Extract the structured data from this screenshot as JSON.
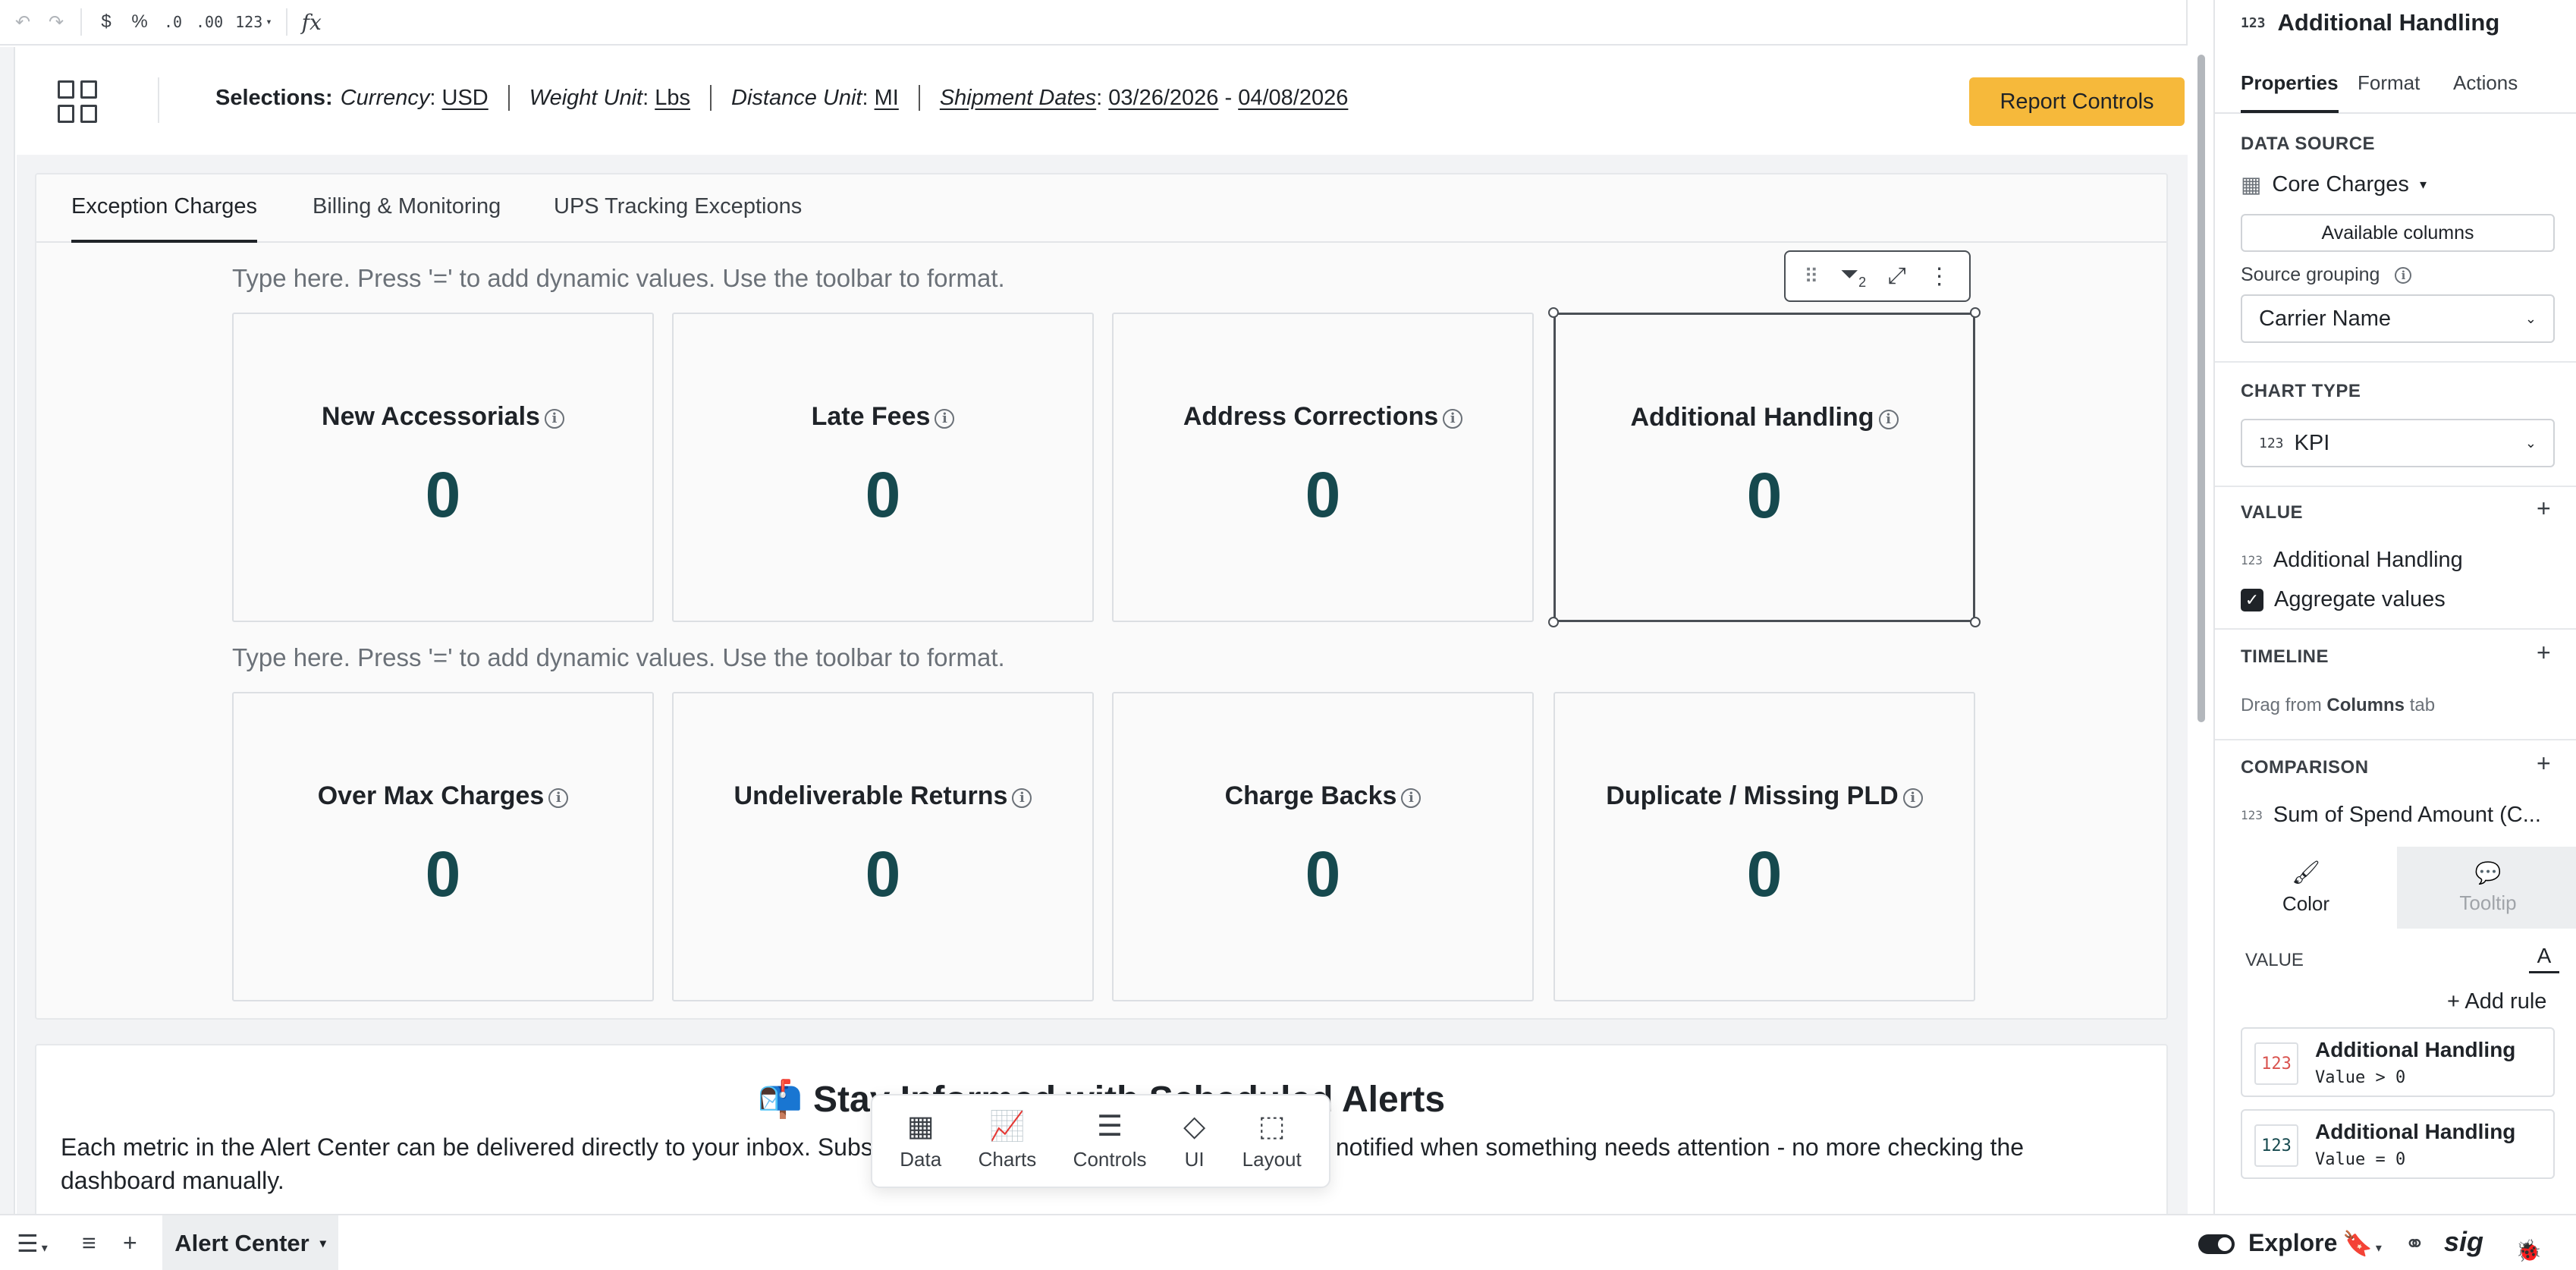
{
  "toolbar": {
    "undo": "↶",
    "redo": "↷",
    "currency": "$",
    "percent": "%",
    "decrease_decimals": ".0",
    "increase_decimals": ".00",
    "number_format": "123",
    "formula": "fx"
  },
  "selections": {
    "title": "Selections:",
    "currency_key": "Currency",
    "currency_value": "USD",
    "weight_key": "Weight Unit",
    "weight_value": "Lbs",
    "distance_key": "Distance Unit",
    "distance_value": "MI",
    "dates_key": "Shipment Dates",
    "date_start": "03/26/2026",
    "date_sep": "-",
    "date_end": "04/08/2026",
    "report_controls": "Report Controls"
  },
  "tabs": [
    {
      "label": "Exception Charges",
      "active": true
    },
    {
      "label": "Billing & Monitoring",
      "active": false
    },
    {
      "label": "UPS Tracking Exceptions",
      "active": false
    }
  ],
  "hint_text": "Type here. Press '=' to add dynamic values. Use the toolbar to format.",
  "kpis_row1": [
    {
      "title": "New Accessorials",
      "value": "0"
    },
    {
      "title": "Late Fees",
      "value": "0"
    },
    {
      "title": "Address Corrections",
      "value": "0"
    },
    {
      "title": "Additional Handling",
      "value": "0"
    }
  ],
  "kpis_row2": [
    {
      "title": "Over Max Charges",
      "value": "0"
    },
    {
      "title": "Undeliverable Returns",
      "value": "0"
    },
    {
      "title": "Charge Backs",
      "value": "0"
    },
    {
      "title": "Duplicate / Missing PLD",
      "value": "0"
    }
  ],
  "element_toolbar": {
    "filter_count": "2"
  },
  "info": {
    "emoji": "📬",
    "title": "Stay Informed with Scheduled Alerts",
    "body": "Each metric in the Alert Center can be delivered directly to your inbox. Subscribe to the alerts that matter most and get notified when something needs attention - no more checking the dashboard manually."
  },
  "add_menu": [
    {
      "label": "Data",
      "icon": "table-icon"
    },
    {
      "label": "Charts",
      "icon": "chart-icon"
    },
    {
      "label": "Controls",
      "icon": "sliders-icon"
    },
    {
      "label": "UI",
      "icon": "shapes-icon"
    },
    {
      "label": "Layout",
      "icon": "layout-icon"
    }
  ],
  "bottom_bar": {
    "sheet_tab": "Alert Center",
    "explore": "Explore",
    "logo": "sig"
  },
  "properties": {
    "header": "Additional Handling",
    "tabs": [
      "Properties",
      "Format",
      "Actions"
    ],
    "data_source_label": "DATA SOURCE",
    "data_source": "Core Charges",
    "available_columns": "Available columns",
    "source_grouping_label": "Source grouping",
    "source_grouping": "Carrier Name",
    "chart_type_label": "CHART TYPE",
    "chart_type": "KPI",
    "value_label": "VALUE",
    "value_field": "Additional Handling",
    "aggregate": "Aggregate values",
    "timeline_label": "TIMELINE",
    "timeline_hint_pre": "Drag from",
    "timeline_hint_bold": "Columns",
    "timeline_hint_post": "tab",
    "comparison_label": "COMPARISON",
    "comparison_field": "Sum of Spend Amount (C...",
    "color_tab": "Color",
    "tooltip_tab": "Tooltip",
    "cf_value_label": "VALUE",
    "cf_letter": "A",
    "add_rule": "+ Add rule",
    "rules": [
      {
        "title": "Additional Handling",
        "condition": "Value > 0",
        "badge_color": "#d9534f"
      },
      {
        "title": "Additional Handling",
        "condition": "Value = 0",
        "badge_color": "#16494e"
      }
    ]
  },
  "colors": {
    "accent": "#f6b93b",
    "kpi_value": "#16494e"
  }
}
